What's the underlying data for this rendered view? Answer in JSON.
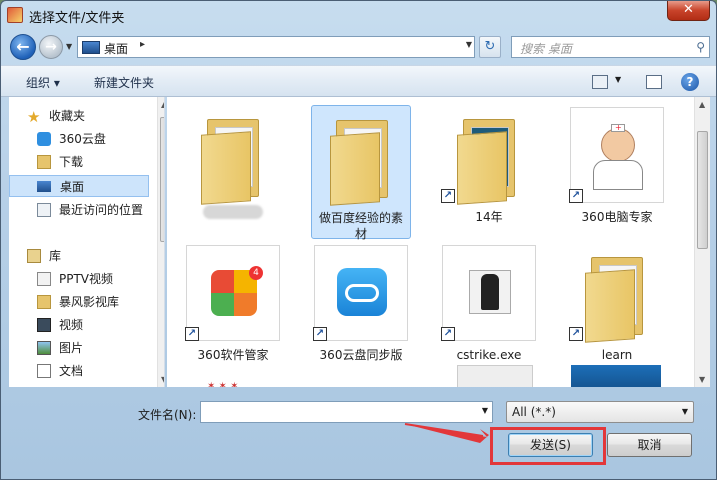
{
  "window": {
    "title": "选择文件/文件夹",
    "close_label": "✕"
  },
  "nav": {
    "address": "桌面",
    "address_sep": "▸",
    "search_placeholder": "搜索 桌面"
  },
  "toolbar": {
    "organize": "组织 ▾",
    "new_folder": "新建文件夹"
  },
  "sidebar": {
    "favorites": "收藏夹",
    "items_fav": [
      "360云盘",
      "下载",
      "桌面",
      "最近访问的位置"
    ],
    "library": "库",
    "items_lib": [
      "PPTV视频",
      "暴风影视库",
      "视频",
      "图片",
      "文档"
    ],
    "selected": "桌面"
  },
  "files": [
    {
      "name": "",
      "kind": "folder-blurred"
    },
    {
      "name": "做百度经验的素材",
      "kind": "folder",
      "selected": true
    },
    {
      "name": "14年",
      "kind": "folder-shortcut"
    },
    {
      "name": "360电脑专家",
      "kind": "app-doctor"
    },
    {
      "name": "360软件管家",
      "kind": "app-360soft"
    },
    {
      "name": "360云盘同步版",
      "kind": "app-cloud"
    },
    {
      "name": "cstrike.exe",
      "kind": "app-cs"
    },
    {
      "name": "learn",
      "kind": "folder"
    }
  ],
  "bottom": {
    "filename_label": "文件名(N):",
    "filename_value": "",
    "filetype": "All (*.*)",
    "send_button": "发送(S)",
    "cancel_button": "取消"
  },
  "colors": {
    "selection": "#cfe6fd",
    "highlight_border": "#e2373a",
    "accent_blue": "#1f61b8"
  }
}
